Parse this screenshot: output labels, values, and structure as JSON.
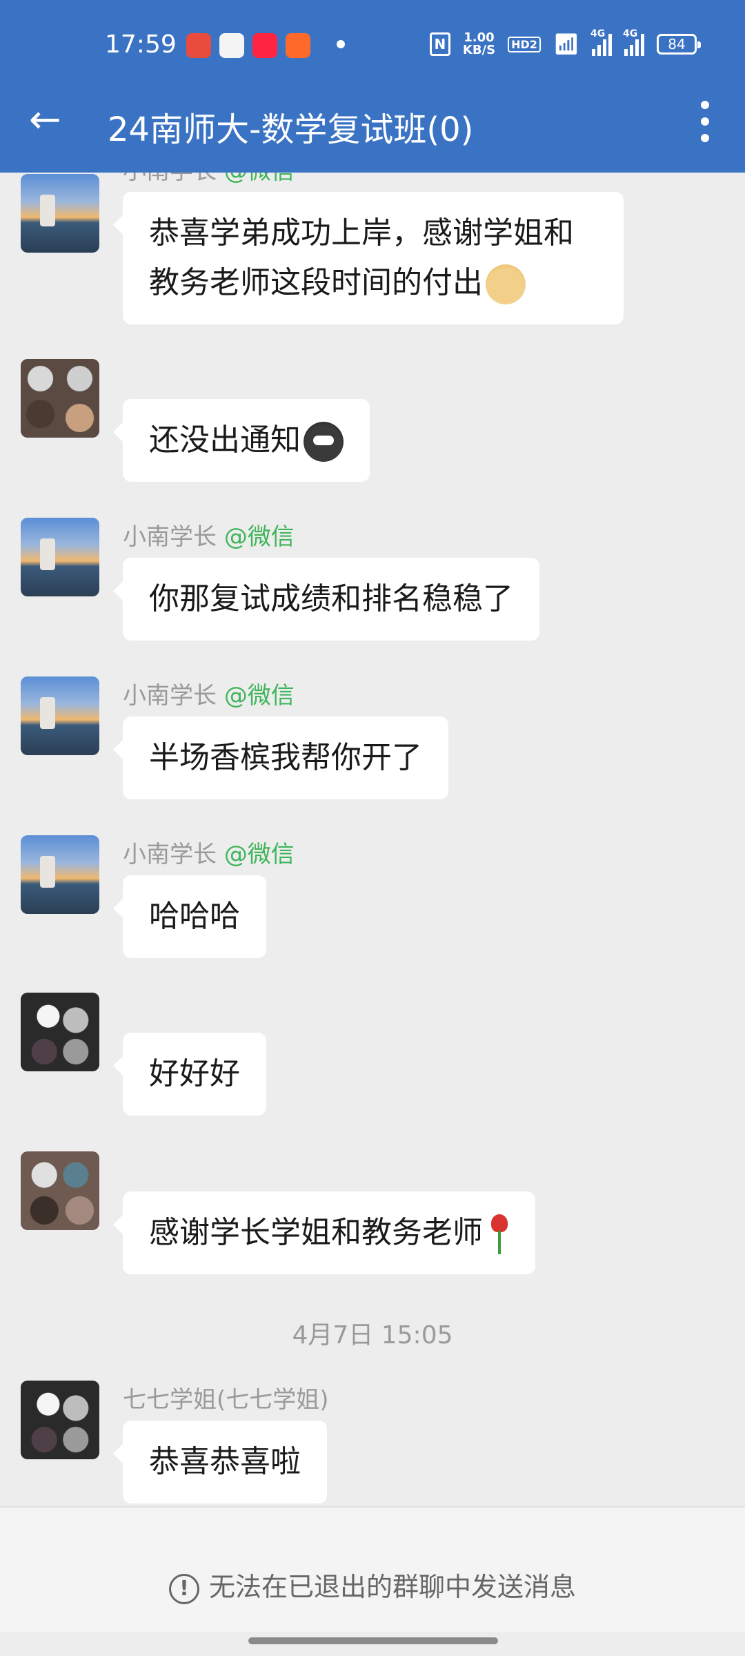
{
  "status_bar": {
    "time": "17:59",
    "network_speed_value": "1.00",
    "network_speed_unit": "KB/S",
    "hd_label": "HD2",
    "signal_label_1": "4G",
    "signal_label_2": "4G",
    "battery": "84"
  },
  "header": {
    "title": "24南师大-数学复试班(0)"
  },
  "messages": [
    {
      "name": "小南学长",
      "source": "@微信",
      "text": "恭喜学弟成功上岸，感谢学姐和教务老师这段时间的付出"
    },
    {
      "name": "",
      "source": "",
      "text": "还没出通知"
    },
    {
      "name": "小南学长",
      "source": "@微信",
      "text": "你那复试成绩和排名稳稳了"
    },
    {
      "name": "小南学长",
      "source": "@微信",
      "text": "半场香槟我帮你开了"
    },
    {
      "name": "小南学长",
      "source": "@微信",
      "text": "哈哈哈"
    },
    {
      "name": "",
      "source": "",
      "text": "好好好"
    },
    {
      "name": "",
      "source": "",
      "text": "感谢学长学姐和教务老师"
    },
    {
      "name": "七七学姐(七七学姐)",
      "source": "",
      "text": "恭喜恭喜啦"
    }
  ],
  "timestamp": "4月7日  15:05",
  "notice": {
    "text": "无法在已退出的群聊中发送消息"
  }
}
